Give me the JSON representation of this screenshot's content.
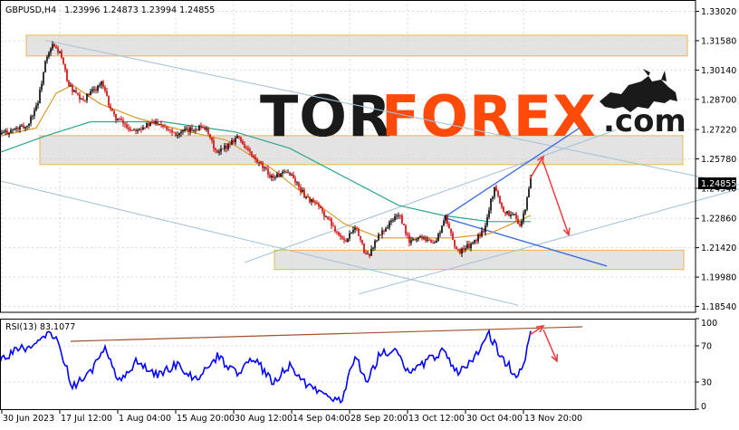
{
  "header": {
    "symbol": "GBPUSD,H4",
    "ohlc": "1.23996 1.24873 1.23994 1.24855",
    "rsi_label": "RSI(13) 83.1077"
  },
  "logo": {
    "part1": "TOR",
    "part2": "FOREX",
    "part3": ".com",
    "colors": {
      "tor": "#1a1a1a",
      "forex": "#ff4a0a",
      "com": "#1a1a1a"
    },
    "icon": "bull-icon"
  },
  "current_price_label": "1.24855",
  "colors": {
    "bull": "#000000",
    "bear": "#d00000",
    "ma_fast": "#d99a2b",
    "ma_slow": "#2ea58f",
    "rsi": "#0000ff",
    "trend_light": "#a8c4d8",
    "trend_blue": "#3d6fe0",
    "arrow": "#ef3b3b",
    "rsi_trend": "#a0522d",
    "zone_border": "#f2b54a"
  },
  "chart_data": [
    {
      "type": "candlestick",
      "price_axis_labels": [
        "1.33020",
        "1.31580",
        "1.30140",
        "1.28700",
        "1.27220",
        "1.25780",
        "1.24340",
        "1.22860",
        "1.21420",
        "1.19980",
        "1.18540"
      ],
      "ylim": [
        1.1825,
        1.334
      ],
      "time_axis_labels": [
        "30 Jun 2023",
        "17 Jul 12:00",
        "1 Aug 04:00",
        "15 Aug 20:00",
        "30 Aug 12:00",
        "14 Sep 04:00",
        "28 Sep 20:00",
        "13 Oct 12:00",
        "30 Oct 04:00",
        "13 Nov 20:00"
      ],
      "last_price": 1.24855,
      "close_path": [
        {
          "t": 0,
          "p": 1.27
        },
        {
          "t": 30,
          "p": 1.274
        },
        {
          "t": 42,
          "p": 1.286
        },
        {
          "t": 50,
          "p": 1.305
        },
        {
          "t": 58,
          "p": 1.3135
        },
        {
          "t": 66,
          "p": 1.31
        },
        {
          "t": 76,
          "p": 1.294
        },
        {
          "t": 90,
          "p": 1.286
        },
        {
          "t": 112,
          "p": 1.295
        },
        {
          "t": 125,
          "p": 1.279
        },
        {
          "t": 145,
          "p": 1.272
        },
        {
          "t": 175,
          "p": 1.276
        },
        {
          "t": 195,
          "p": 1.27
        },
        {
          "t": 225,
          "p": 1.274
        },
        {
          "t": 240,
          "p": 1.26
        },
        {
          "t": 262,
          "p": 1.269
        },
        {
          "t": 282,
          "p": 1.257
        },
        {
          "t": 300,
          "p": 1.249
        },
        {
          "t": 320,
          "p": 1.251
        },
        {
          "t": 336,
          "p": 1.24
        },
        {
          "t": 352,
          "p": 1.234
        },
        {
          "t": 366,
          "p": 1.226
        },
        {
          "t": 380,
          "p": 1.217
        },
        {
          "t": 392,
          "p": 1.225
        },
        {
          "t": 405,
          "p": 1.209
        },
        {
          "t": 418,
          "p": 1.22
        },
        {
          "t": 440,
          "p": 1.231
        },
        {
          "t": 452,
          "p": 1.217
        },
        {
          "t": 466,
          "p": 1.22
        },
        {
          "t": 480,
          "p": 1.216
        },
        {
          "t": 492,
          "p": 1.229
        },
        {
          "t": 505,
          "p": 1.212
        },
        {
          "t": 522,
          "p": 1.216
        },
        {
          "t": 534,
          "p": 1.223
        },
        {
          "t": 546,
          "p": 1.244
        },
        {
          "t": 556,
          "p": 1.232
        },
        {
          "t": 568,
          "p": 1.23
        },
        {
          "t": 575,
          "p": 1.225
        },
        {
          "t": 580,
          "p": 1.233
        },
        {
          "t": 586,
          "p": 1.2485
        }
      ],
      "ma_fast": [
        {
          "t": 0,
          "p": 1.269
        },
        {
          "t": 40,
          "p": 1.273
        },
        {
          "t": 62,
          "p": 1.29
        },
        {
          "t": 80,
          "p": 1.294
        },
        {
          "t": 110,
          "p": 1.285
        },
        {
          "t": 150,
          "p": 1.278
        },
        {
          "t": 200,
          "p": 1.272
        },
        {
          "t": 250,
          "p": 1.267
        },
        {
          "t": 300,
          "p": 1.253
        },
        {
          "t": 340,
          "p": 1.239
        },
        {
          "t": 380,
          "p": 1.226
        },
        {
          "t": 420,
          "p": 1.219
        },
        {
          "t": 460,
          "p": 1.219
        },
        {
          "t": 500,
          "p": 1.219
        },
        {
          "t": 540,
          "p": 1.221
        },
        {
          "t": 586,
          "p": 1.23
        }
      ],
      "ma_slow": [
        {
          "t": 0,
          "p": 1.261
        },
        {
          "t": 50,
          "p": 1.269
        },
        {
          "t": 100,
          "p": 1.276
        },
        {
          "t": 180,
          "p": 1.276
        },
        {
          "t": 260,
          "p": 1.271
        },
        {
          "t": 320,
          "p": 1.263
        },
        {
          "t": 380,
          "p": 1.249
        },
        {
          "t": 440,
          "p": 1.235
        },
        {
          "t": 490,
          "p": 1.23
        },
        {
          "t": 540,
          "p": 1.227
        },
        {
          "t": 586,
          "p": 1.227
        }
      ],
      "zones": [
        {
          "top": 1.3185,
          "bottom": 1.3083
        },
        {
          "top": 1.2692,
          "bottom": 1.255
        },
        {
          "top": 1.213,
          "bottom": 1.2035
        }
      ],
      "trendlines": [
        {
          "style": "light",
          "from": {
            "t": 50,
            "p": 1.316
          },
          "to": {
            "t": 816,
            "p": 1.245
          }
        },
        {
          "style": "light",
          "from": {
            "t": 0,
            "p": 1.247
          },
          "to": {
            "t": 572,
            "p": 1.186
          }
        },
        {
          "style": "light",
          "from": {
            "t": 270,
            "p": 1.207
          },
          "to": {
            "t": 680,
            "p": 1.272
          }
        },
        {
          "style": "light",
          "from": {
            "t": 396,
            "p": 1.1915
          },
          "to": {
            "t": 816,
            "p": 1.243
          }
        },
        {
          "style": "blue",
          "from": {
            "t": 490,
            "p": 1.229
          },
          "to": {
            "t": 640,
            "p": 1.273
          }
        },
        {
          "style": "blue",
          "from": {
            "t": 490,
            "p": 1.229
          },
          "to": {
            "t": 670,
            "p": 1.2052
          }
        }
      ],
      "arrows": [
        {
          "from": {
            "t": 585,
            "p": 1.248
          },
          "to": {
            "t": 600,
            "p": 1.259
          }
        },
        {
          "from": {
            "t": 600,
            "p": 1.256
          },
          "to": {
            "t": 628,
            "p": 1.2205
          }
        }
      ]
    },
    {
      "type": "line",
      "name": "RSI(13)",
      "value": 83.1077,
      "ylim": [
        0,
        100
      ],
      "y_axis_labels": [
        "100",
        "70",
        "30",
        "0"
      ],
      "levels": [
        70,
        30
      ],
      "rsi_path": [
        {
          "t": 0,
          "v": 54
        },
        {
          "t": 20,
          "v": 66
        },
        {
          "t": 40,
          "v": 71
        },
        {
          "t": 55,
          "v": 84
        },
        {
          "t": 65,
          "v": 72
        },
        {
          "t": 80,
          "v": 25
        },
        {
          "t": 100,
          "v": 40
        },
        {
          "t": 115,
          "v": 68
        },
        {
          "t": 130,
          "v": 30
        },
        {
          "t": 150,
          "v": 52
        },
        {
          "t": 175,
          "v": 38
        },
        {
          "t": 195,
          "v": 50
        },
        {
          "t": 215,
          "v": 32
        },
        {
          "t": 240,
          "v": 58
        },
        {
          "t": 262,
          "v": 40
        },
        {
          "t": 282,
          "v": 56
        },
        {
          "t": 300,
          "v": 30
        },
        {
          "t": 320,
          "v": 47
        },
        {
          "t": 340,
          "v": 24
        },
        {
          "t": 360,
          "v": 20
        },
        {
          "t": 376,
          "v": 7
        },
        {
          "t": 392,
          "v": 60
        },
        {
          "t": 405,
          "v": 30
        },
        {
          "t": 420,
          "v": 62
        },
        {
          "t": 440,
          "v": 65
        },
        {
          "t": 452,
          "v": 38
        },
        {
          "t": 470,
          "v": 52
        },
        {
          "t": 490,
          "v": 66
        },
        {
          "t": 505,
          "v": 40
        },
        {
          "t": 522,
          "v": 55
        },
        {
          "t": 540,
          "v": 82
        },
        {
          "t": 556,
          "v": 55
        },
        {
          "t": 570,
          "v": 38
        },
        {
          "t": 578,
          "v": 50
        },
        {
          "t": 586,
          "v": 83
        }
      ],
      "trendline": {
        "from": {
          "t": 78,
          "v": 75
        },
        "to": {
          "t": 643,
          "v": 91
        }
      },
      "arrows": [
        {
          "from": {
            "t": 585,
            "v": 82
          },
          "to": {
            "t": 600,
            "v": 92
          }
        },
        {
          "from": {
            "t": 600,
            "v": 88
          },
          "to": {
            "t": 615,
            "v": 53
          }
        }
      ]
    }
  ]
}
